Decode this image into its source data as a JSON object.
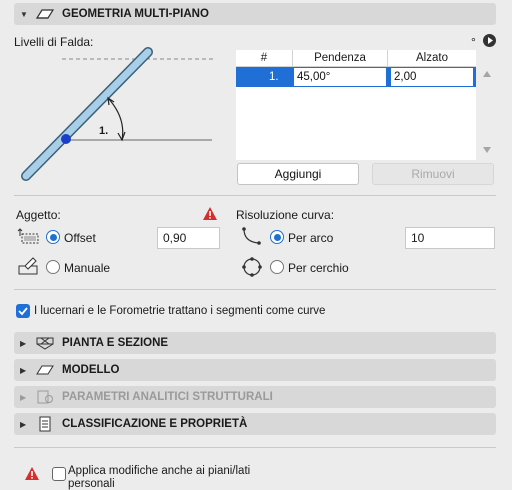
{
  "header": {
    "title": "GEOMETRIA MULTI-PIANO"
  },
  "levels": {
    "label": "Livelli di Falda:",
    "degree_symbol": "°",
    "columns": [
      "#",
      "Pendenza",
      "Alzato"
    ],
    "rows": [
      {
        "num": "1.",
        "pendenza": "45,00°",
        "alzato": "2,00"
      }
    ],
    "diagram_label": "1.",
    "add_button": "Aggiungi",
    "remove_button": "Rimuovi"
  },
  "aggetto": {
    "label": "Aggetto:",
    "offset_label": "Offset",
    "offset_value": "0,90",
    "manual_label": "Manuale"
  },
  "curva": {
    "label": "Risoluzione curva:",
    "arc_label": "Per arco",
    "arc_value": "10",
    "circle_label": "Per cerchio"
  },
  "checkbox_label": "I lucernari e le Forometrie trattano i segmenti come curve",
  "sections": [
    {
      "title": "PIANTA E SEZIONE",
      "icon": "plan-section-icon",
      "enabled": true
    },
    {
      "title": "MODELLO",
      "icon": "model-icon",
      "enabled": true
    },
    {
      "title": "PARAMETRI ANALITICI STRUTTURALI",
      "icon": "structural-analysis-icon",
      "enabled": false
    },
    {
      "title": "CLASSIFICAZIONE E PROPRIETÀ",
      "icon": "classification-icon",
      "enabled": true
    }
  ],
  "footer": {
    "line1": "Applica modifiche anche ai piani/lati",
    "line2": "personali"
  },
  "colors": {
    "accent": "#1f6fd6",
    "warning": "#d32f2f",
    "header_bg": "#d8d8d8",
    "diagram_line": "#a9cfe8"
  }
}
